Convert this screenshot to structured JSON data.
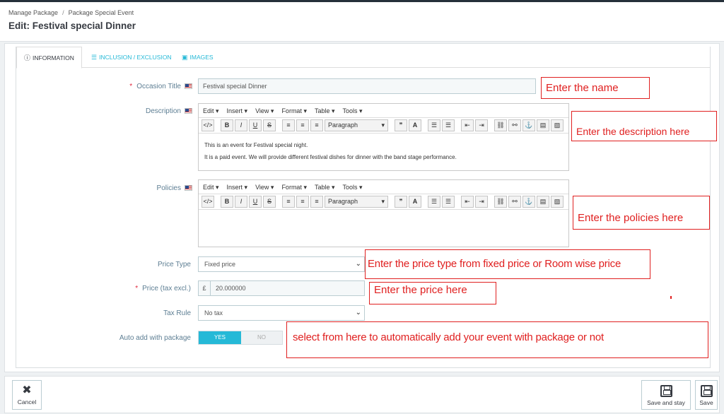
{
  "breadcrumb": {
    "items": [
      "Manage Package",
      "Package Special Event"
    ],
    "separator": "/"
  },
  "page_title": "Edit: Festival special Dinner",
  "tabs": [
    {
      "label": "INFORMATION",
      "icon": "info-icon"
    },
    {
      "label": "INCLUSION / EXCLUSION",
      "icon": "list-icon"
    },
    {
      "label": "IMAGES",
      "icon": "image-icon"
    }
  ],
  "form": {
    "occasion_title": {
      "label": "Occasion Title",
      "value": "Festival special Dinner"
    },
    "description": {
      "label": "Description",
      "lines": [
        "This is an event for Festival special night.",
        "It is a paid event.  We will provide different festival dishes for dinner with the band stage performance."
      ]
    },
    "policies": {
      "label": "Policies"
    },
    "price_type": {
      "label": "Price Type",
      "value": "Fixed price"
    },
    "price": {
      "label": "Price (tax excl.)",
      "currency": "£",
      "value": "20.000000"
    },
    "tax_rule": {
      "label": "Tax Rule",
      "value": "No tax"
    },
    "auto_add": {
      "label": "Auto add with package",
      "yes": "YES",
      "no": "NO",
      "selected": "YES"
    }
  },
  "editor": {
    "menus": [
      "Edit ▾",
      "Insert ▾",
      "View ▾",
      "Format ▾",
      "Table ▾",
      "Tools ▾"
    ],
    "format_select": "Paragraph"
  },
  "callouts": {
    "name": "Enter the name",
    "description": "Enter the description here",
    "policies": "Enter the policies here",
    "price_type": "Enter the price type from fixed price or Room wise price",
    "price": "Enter the price here",
    "auto_add": "select from here to automatically add your event with package or not"
  },
  "footer": {
    "cancel": "Cancel",
    "save_and_stay": "Save and stay",
    "save": "Save"
  },
  "colors": {
    "accent": "#25b9d7",
    "callout": "#e02020",
    "required": "#e0293e"
  }
}
